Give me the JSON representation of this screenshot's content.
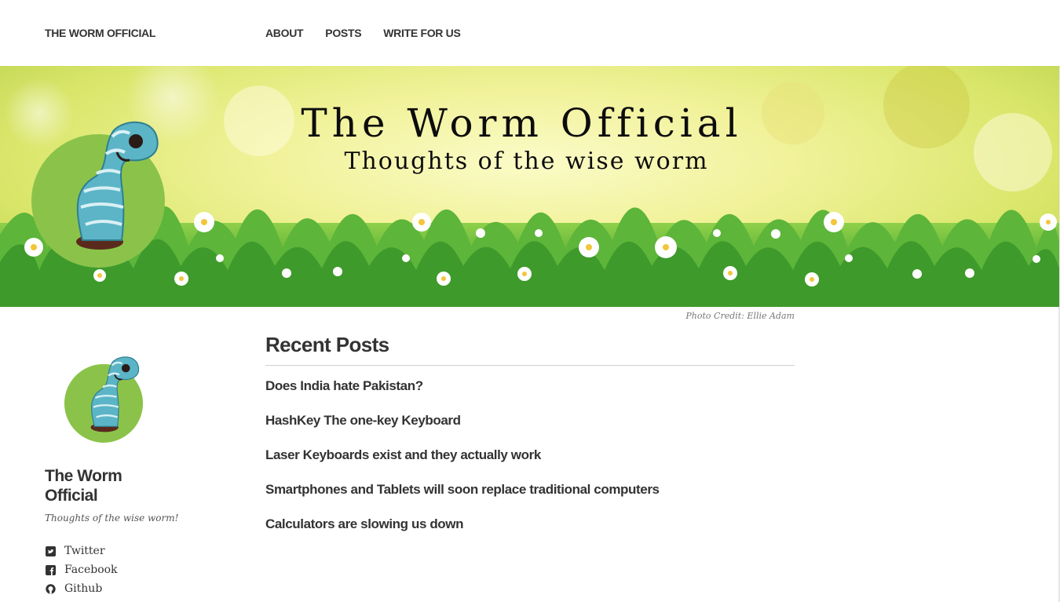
{
  "header": {
    "site_title": "THE WORM OFFICIAL",
    "nav": [
      {
        "label": "ABOUT"
      },
      {
        "label": "POSTS"
      },
      {
        "label": "WRITE FOR US"
      }
    ]
  },
  "banner": {
    "title": "The Worm Official",
    "tagline": "Thoughts of the wise worm",
    "photo_credit": "Photo Credit: Ellie Adam"
  },
  "sidebar": {
    "name": "The Worm Official",
    "tagline": "Thoughts of the wise worm!",
    "social": [
      {
        "label": "Twitter",
        "icon": "twitter-icon"
      },
      {
        "label": "Facebook",
        "icon": "facebook-icon"
      },
      {
        "label": "Github",
        "icon": "github-icon"
      }
    ]
  },
  "main": {
    "section_title": "Recent Posts",
    "posts": [
      {
        "title": "Does India hate Pakistan?"
      },
      {
        "title": "HashKey The one-key Keyboard"
      },
      {
        "title": "Laser Keyboards exist and they actually work"
      },
      {
        "title": "Smartphones and Tablets will soon replace traditional computers"
      },
      {
        "title": "Calculators are slowing us down"
      }
    ]
  },
  "colors": {
    "text": "#333333",
    "logo_green": "#8bc34a",
    "worm_blue": "#5bb5c6",
    "grass": "#3f9b2c"
  }
}
